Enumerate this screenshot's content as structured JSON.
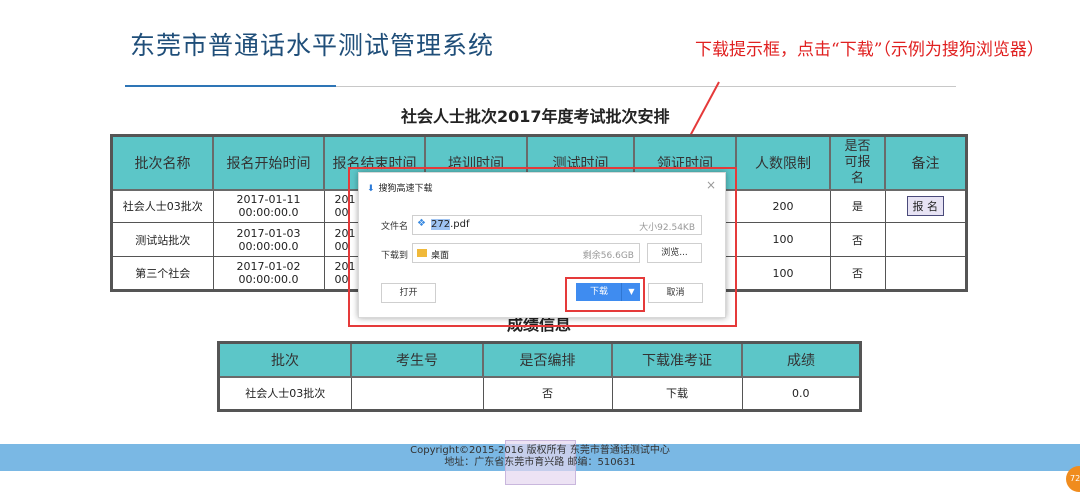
{
  "header": {
    "title": "东莞市普通话水平测试管理系统"
  },
  "annotation": {
    "text": "下载提示框，点击“下载”（示例为搜狗浏览器）"
  },
  "batches": {
    "title": "社会人士批次2017年度考试批次安排",
    "columns": [
      "批次名称",
      "报名开始时间",
      "报名结束时间",
      "培训时间",
      "测试时间",
      "领证时间",
      "人数限制",
      "是否可报名",
      "备注"
    ],
    "rows": [
      {
        "name": "社会人士03批次",
        "start": "2017-01-11 00:00:00.0",
        "end_partial": "201\n00",
        "limit": "200",
        "can_register": "是",
        "note_button": "报 名"
      },
      {
        "name": "测试站批次",
        "start": "2017-01-03 00:00:00.0",
        "end_partial": "201\n00",
        "limit": "100",
        "can_register": "否",
        "note_button": ""
      },
      {
        "name": "第三个社会",
        "start": "2017-01-02 00:00:00.0",
        "end_partial": "201\n00",
        "limit": "100",
        "can_register": "否",
        "note_button": ""
      }
    ]
  },
  "scores": {
    "title": "成绩信息",
    "columns": [
      "批次",
      "考生号",
      "是否编排",
      "下载准考证",
      "成绩"
    ],
    "rows": [
      {
        "batch": "社会人士03批次",
        "exam_no": "",
        "arranged": "否",
        "download": "下载",
        "score": "0.0"
      }
    ]
  },
  "download_dialog": {
    "title": "搜狗高速下载",
    "close": "×",
    "filename_label": "文件名",
    "filename_base": "272",
    "filename_ext": ".pdf",
    "size": "大小92.54KB",
    "saveto_label": "下载到",
    "saveto_value": "桌面",
    "free_space": "剩余56.6GB",
    "browse_label": "浏览...",
    "open_label": "打开",
    "download_label": "下载",
    "cancel_label": "取消"
  },
  "footer": {
    "line1": "Copyright©2015-2016 版权所有 东莞市普通话测试中心",
    "line2": "地址：广东省东莞市育兴路 邮编：510631"
  },
  "badge": {
    "text": "72"
  },
  "colors": {
    "header_cell": "#5cc6c8",
    "title": "#1f4e79",
    "accent_red": "#e53a3a",
    "footer": "#7ab8e4",
    "primary_button": "#3f8cf0"
  }
}
